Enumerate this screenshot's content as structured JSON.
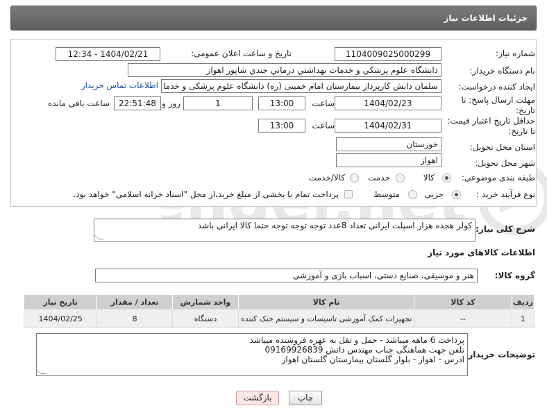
{
  "header": {
    "title": "جزئیات اطلاعات نیاز"
  },
  "form": {
    "need_number": {
      "label": "شماره نیاز:",
      "value": "1104009025000299"
    },
    "announce": {
      "label": "تاریخ و ساعت اعلان عمومی:",
      "value": "1404/02/21 - 12:34"
    },
    "buyer_org": {
      "label": "نام دستگاه خریدار:",
      "value": "دانشگاه علوم پزشكي و خدمات بهداشتي درماني جندي شاپور اهواز"
    },
    "requester": {
      "label": "ایجاد کننده درخواست:",
      "value": "سلمان دانش کارپرداز بیمارستان امام خمینی (ره) دانشگاه علوم پزشکی و خدما",
      "contact_link": "اطلاعات تماس خریدار"
    },
    "deadline": {
      "label_line1": "مهلت ارسال پاسخ: تا",
      "label_line2": "تاریخ:",
      "date": "1404/02/23",
      "time_label": "ساعت",
      "time": "13:00",
      "days": "1",
      "days_label": "روز و",
      "remaining": "22:51:48",
      "remaining_label": "ساعت باقی مانده"
    },
    "price_validity": {
      "label_line1": "حداقل تاریخ اعتبار قیمت:",
      "label_line2": "تا تاریخ:",
      "date": "1404/02/31",
      "time_label": "ساعت",
      "time": "13:00"
    },
    "province": {
      "label": "استان محل تحویل:",
      "value": "خوزستان"
    },
    "city": {
      "label": "شهر محل تحویل:",
      "value": "اهواز"
    },
    "category": {
      "label": "طبقه بندی موضوعی:",
      "options": [
        "کالا",
        "خدمت",
        "کالا/خدمت"
      ],
      "selected": "کالا"
    },
    "purchase_type": {
      "label": "نوع فرآیند خرید :",
      "options": [
        "جزیی",
        "متوسط"
      ],
      "selected": "جزیی",
      "treasury_note": "پرداخت تمام یا بخشی از مبلغ خرید،از محل \"اسناد خزانه اسلامی\" خواهد بود."
    }
  },
  "summary": {
    "label": "شرح کلی نیاز:",
    "value": "کولر هجده هزار اسپلت ایرانی تعداد 8عدد  توجه توجه توجه حتما کالا ایرانی باشد"
  },
  "goods_section": {
    "title": "اطلاعات کالاهای مورد نیاز"
  },
  "goods_group": {
    "label": "گروه کالا:",
    "value": "هنر و موسیقی، صنایع دستی، اسباب بازی و آموزشی"
  },
  "table": {
    "headers": [
      "ردیف",
      "کد کالا",
      "نام کالا",
      "واحد شمارش",
      "تعداد / مقدار",
      "تاریخ نیاز"
    ],
    "rows": [
      [
        "1",
        "--",
        "تجهیزات کمک آموزشی تاسیسات و سیستم خنک کننده",
        "دستگاه",
        "8",
        "1404/02/25"
      ]
    ]
  },
  "buyer_notes": {
    "label": "توضیحات خریدار:",
    "lines": [
      "پرداخت 6 ماهه میباشد - حمل و نقل به عهره فروشنده میباشد",
      "تلفن جهت هماهنگی جناب مهندس دانش 09169926839",
      "ادرس -  اهواز - بلوار گلستان بیمارستان گلستان اهواز"
    ]
  },
  "buttons": {
    "print": "چاپ",
    "back": "بازگشت"
  },
  "watermark": {
    "text": "AriaTender.net"
  },
  "colors": {
    "header_bg": "#6b6b6b",
    "link": "#1a4fa3",
    "back_button_bg": "#fde8e8"
  }
}
